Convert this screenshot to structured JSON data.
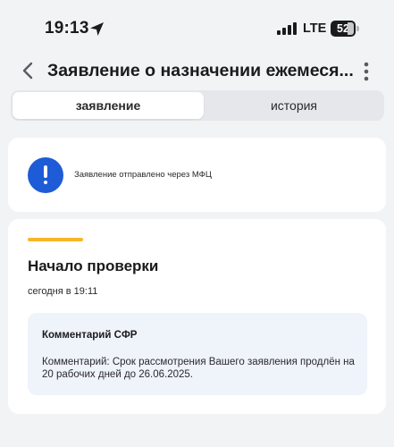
{
  "status_bar": {
    "time": "19:13",
    "location_icon": "location-arrow-icon",
    "signal_icon": "cellular-signal-icon",
    "network": "LTE",
    "battery_level": "52",
    "battery_fraction": 0.52
  },
  "header": {
    "back_icon": "chevron-left-icon",
    "title": "Заявление о назначении ежемеся...",
    "more_icon": "more-vertical-icon"
  },
  "tabs": [
    {
      "label": "заявление",
      "active": true
    },
    {
      "label": "история",
      "active": false
    }
  ],
  "notice": {
    "icon": "exclamation-circle-icon",
    "icon_color": "#1e5bd6",
    "text": "Заявление отправлено через МФЦ"
  },
  "status": {
    "accent_color": "#f7b628",
    "title": "Начало проверки",
    "time": "сегодня в 19:11",
    "comment": {
      "title": "Комментарий СФР",
      "text": "Комментарий: Срок рассмотрения Вашего заявления продлён на 20 рабочих дней до 26.06.2025."
    }
  }
}
